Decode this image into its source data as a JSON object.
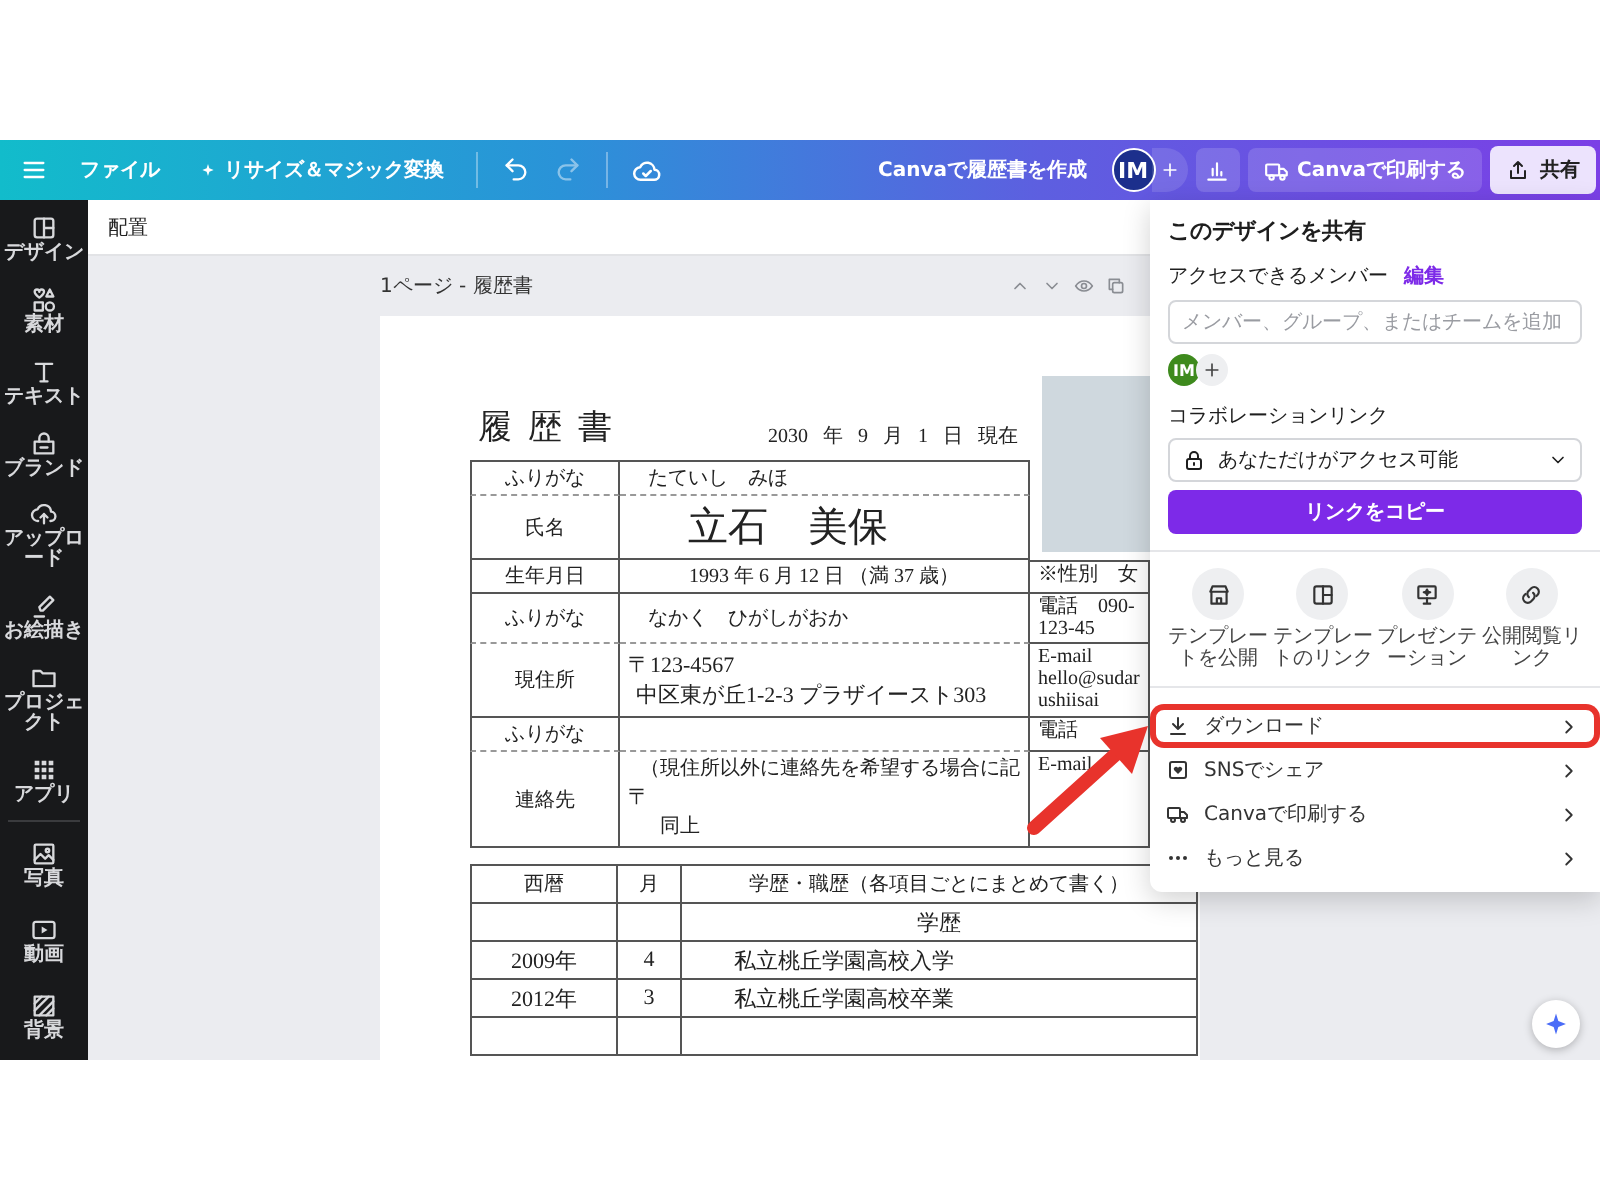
{
  "top_bar": {
    "file_menu": "ファイル",
    "resize_button": "リサイズ＆マジック変換",
    "history": [
      {
        "kind": "undo",
        "disabled": false
      },
      {
        "kind": "redo",
        "disabled": true
      }
    ],
    "create_link": "Canvaで履歴書を作成",
    "avatar": "IM",
    "print_button": "Canvaで印刷する",
    "share_button": {
      "label": "共有",
      "selected": true
    }
  },
  "sidebar": {
    "items": [
      {
        "kind": "design",
        "label": "デザイン"
      },
      {
        "kind": "elements",
        "label": "素材"
      },
      {
        "kind": "text",
        "label": "テキスト"
      },
      {
        "kind": "brand",
        "label": "ブランド"
      },
      {
        "kind": "upload",
        "label": "アップロード"
      },
      {
        "kind": "draw",
        "label": "お絵描き"
      },
      {
        "kind": "projects",
        "label": "プロジェクト"
      },
      {
        "kind": "apps",
        "label": "アプリ"
      }
    ],
    "more_items": [
      {
        "kind": "photos",
        "label": "写真"
      },
      {
        "kind": "video",
        "label": "動画"
      },
      {
        "kind": "background",
        "label": "背景"
      }
    ]
  },
  "toolbar": {
    "position_button": "配置"
  },
  "canvas": {
    "page_label": "1ページ - 履歴書",
    "resume": {
      "title": "履歴書",
      "date": "2030 年 9 月 1 日 現在",
      "rows": [
        {
          "kind": "furigana",
          "label": "ふりがな",
          "value": "たていし　みほ"
        },
        {
          "kind": "name",
          "label": "氏名",
          "value": "立石　美保"
        },
        {
          "kind": "birth",
          "label": "生年月日",
          "value": "1993 年 6 月 12 日 （満 37 歳）",
          "side": [
            "※性別　女"
          ]
        },
        {
          "kind": "furigana",
          "label": "ふりがな",
          "value": "なかく　ひがしがおか",
          "side": [
            "電話　090-123-45"
          ]
        },
        {
          "kind": "address",
          "label": "現住所",
          "lines": [
            "〒123-4567",
            "中区東が丘1-2-3 プラザイースト303"
          ],
          "side": [
            "E-mail",
            "hello@sudarushiisai"
          ]
        },
        {
          "kind": "furigana",
          "label": "ふりがな",
          "side": [
            "電話"
          ]
        },
        {
          "kind": "contact",
          "label": "連絡先",
          "note": "（現住所以外に連絡先を希望する場合に記",
          "lines": [
            "〒",
            "同上"
          ],
          "side": [
            "E-mail"
          ]
        }
      ],
      "history": {
        "columns": [
          "西暦",
          "月",
          "学歴・職歴（各項目ごとにまとめて書く）"
        ],
        "rows": [
          {
            "kind": "heading",
            "text": "学歴"
          },
          {
            "kind": "entry",
            "year": "2009年",
            "month": "4",
            "text": "私立桃丘学園高校入学"
          },
          {
            "kind": "entry",
            "year": "2012年",
            "month": "3",
            "text": "私立桃丘学園高校卒業"
          }
        ]
      }
    }
  },
  "share_panel": {
    "title": "このデザインを共有",
    "members_label": "アクセスできるメンバー",
    "edit_link": "編集",
    "member_field": {
      "placeholder": "メンバー、グループ、またはチームを追加"
    },
    "members": [
      "IM"
    ],
    "collab_label": "コラボレーションリンク",
    "access_select": "あなただけがアクセス可能",
    "copy_button": "リンクをコピー",
    "options": [
      {
        "kind": "template",
        "label": "テンプレートを公開"
      },
      {
        "kind": "template_link",
        "label": "テンプレートのリンク"
      },
      {
        "kind": "presentation",
        "label": "プレゼンテーション"
      },
      {
        "kind": "public_link",
        "label": "公開閲覧リンク"
      }
    ],
    "menu": [
      {
        "kind": "download",
        "label": "ダウンロード",
        "highlighted": true
      },
      {
        "kind": "sns",
        "label": "SNSでシェア",
        "highlighted": false
      },
      {
        "kind": "print",
        "label": "Canvaで印刷する",
        "highlighted": false
      },
      {
        "kind": "more",
        "label": "もっと見る",
        "highlighted": false
      }
    ]
  }
}
